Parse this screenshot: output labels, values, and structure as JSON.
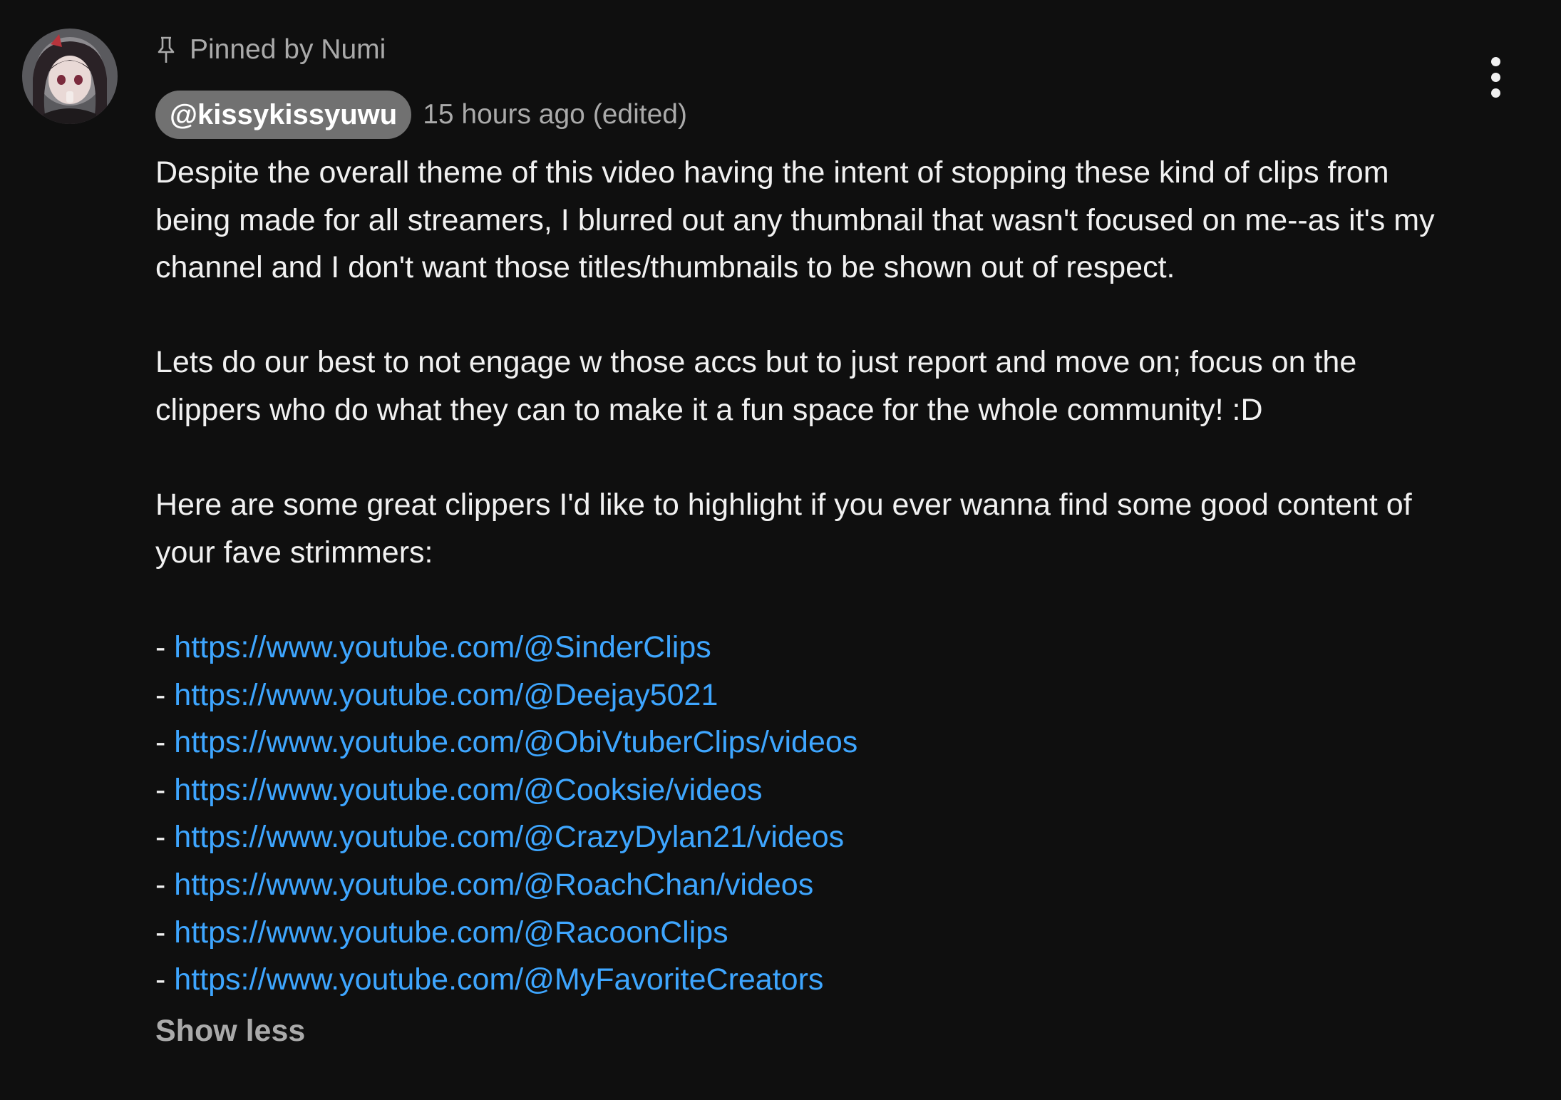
{
  "comment": {
    "pinned_label": "Pinned by Numi",
    "author_handle": "@kissykissyuwu",
    "timestamp": "15 hours ago (edited)",
    "paragraphs": [
      "Despite the overall theme of this video having the intent of stopping these kind of clips from being made for all streamers, I blurred out any thumbnail that wasn't focused on me--as it's my channel and I don't want those titles/thumbnails to be shown out of respect.",
      "Lets do our best to not engage w those accs but to just report and move on; focus on the clippers who do what they can to make it a fun space for the whole community! :D",
      "Here are some great clippers I'd like to highlight if you ever wanna find some good content of your fave strimmers:"
    ],
    "link_prefix": "- ",
    "links": [
      "https://www.youtube.com/@SinderClips",
      "https://www.youtube.com/@Deejay5021",
      "https://www.youtube.com/@ObiVtuberClips/videos",
      "https://www.youtube.com/@Cooksie/videos",
      "https://www.youtube.com/@CrazyDylan21/videos",
      "https://www.youtube.com/@RoachChan/videos",
      "https://www.youtube.com/@RacoonClips",
      "https://www.youtube.com/@MyFavoriteCreators"
    ],
    "show_less_label": "Show less"
  },
  "icons": {
    "pin": "pin-icon",
    "menu": "more-vertical-icon",
    "avatar": "avatar"
  },
  "colors": {
    "background": "#0f0f0f",
    "text": "#f1f1f1",
    "secondary_text": "#aaaaaa",
    "link": "#3ea6ff",
    "handle_badge": "#717171"
  }
}
